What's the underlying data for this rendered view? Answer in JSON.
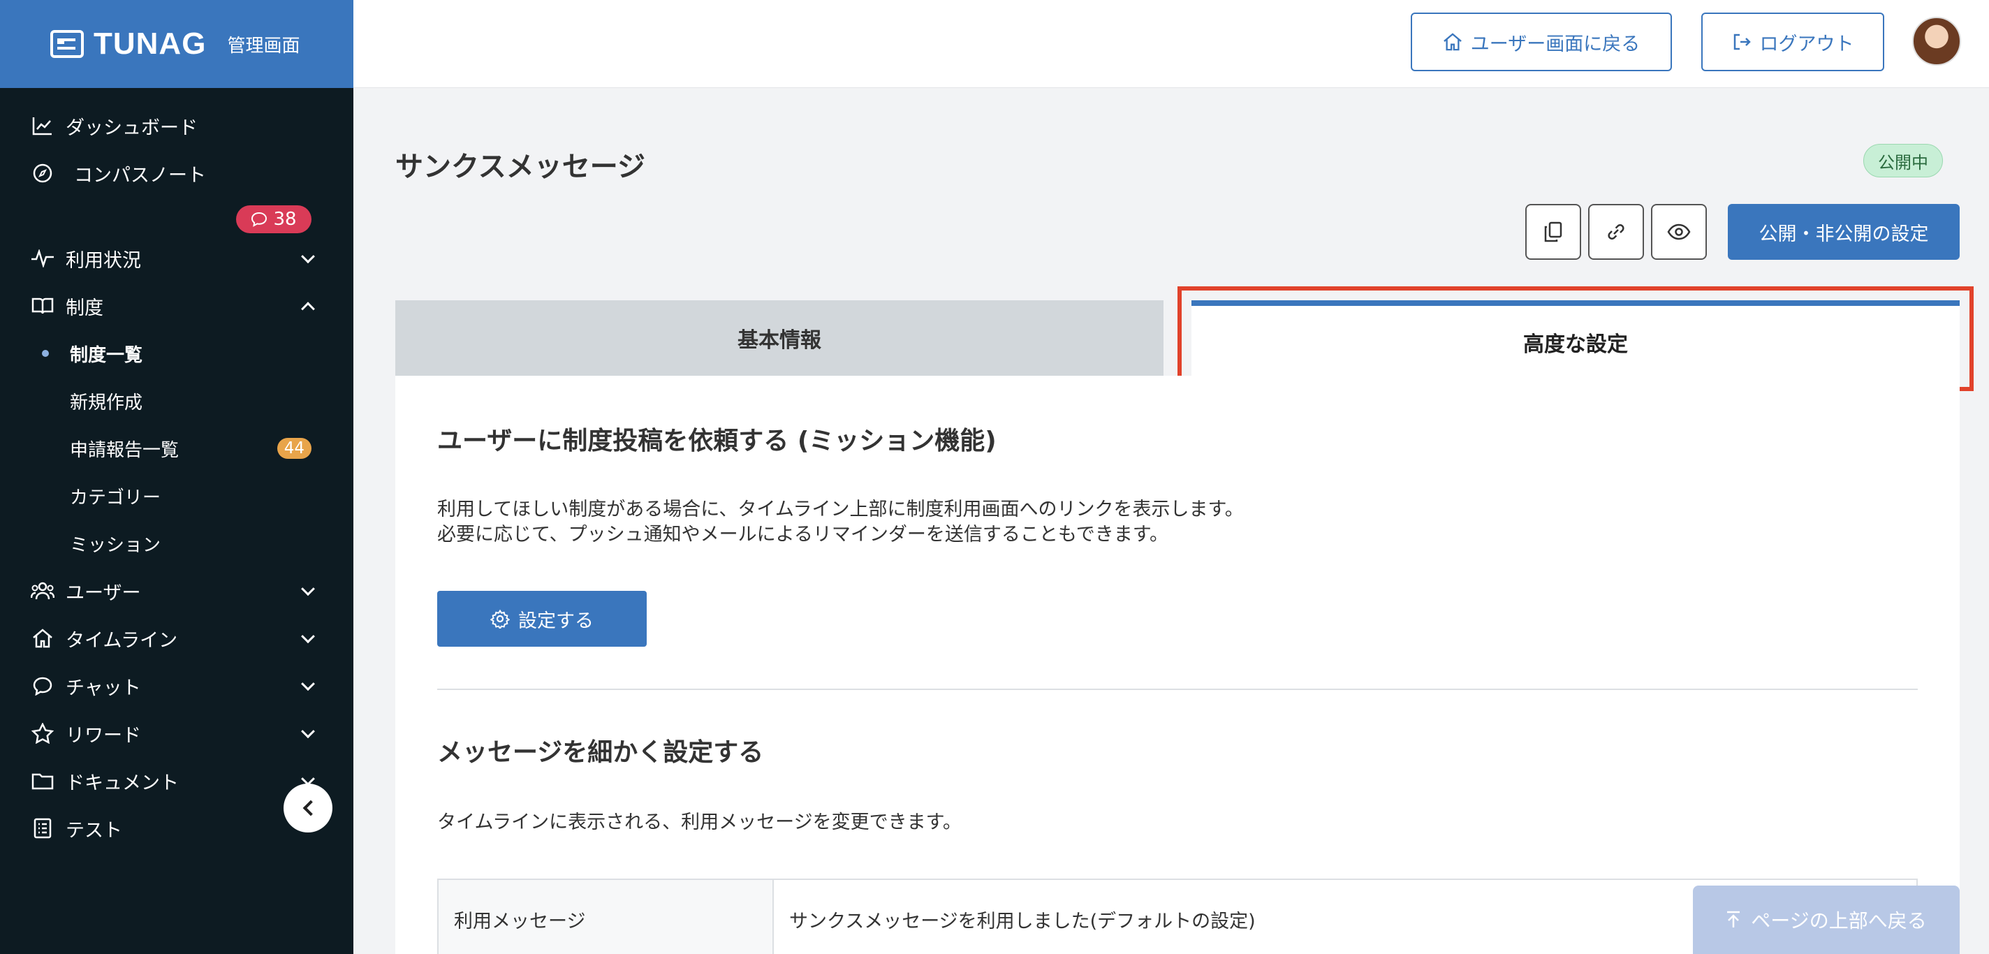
{
  "brand": {
    "name": "TUNAG",
    "subtitle": "管理画面"
  },
  "sidebar": {
    "chat_badge": "38",
    "items": [
      {
        "label": "ダッシュボード",
        "icon": "chart-line-icon"
      },
      {
        "label": "コンパスノート",
        "icon": "compass-icon"
      },
      {
        "label": "利用状況",
        "icon": "pulse-icon",
        "expand": "down"
      },
      {
        "label": "制度",
        "icon": "book-icon",
        "expand": "up"
      },
      {
        "label": "ユーザー",
        "icon": "users-icon",
        "expand": "down"
      },
      {
        "label": "タイムライン",
        "icon": "home-icon",
        "expand": "down"
      },
      {
        "label": "チャット",
        "icon": "chat-icon",
        "expand": "down"
      },
      {
        "label": "リワード",
        "icon": "star-icon",
        "expand": "down"
      },
      {
        "label": "ドキュメント",
        "icon": "folder-icon",
        "expand": "down"
      },
      {
        "label": "テスト",
        "icon": "checklist-icon"
      }
    ],
    "subitems": [
      {
        "label": "制度一覧",
        "active": true
      },
      {
        "label": "新規作成"
      },
      {
        "label": "申請報告一覧",
        "badge": "44"
      },
      {
        "label": "カテゴリー"
      },
      {
        "label": "ミッション"
      }
    ]
  },
  "header": {
    "user_screen_label": "ユーザー画面に戻る",
    "logout_label": "ログアウト"
  },
  "page": {
    "title": "サンクスメッセージ",
    "status": "公開中",
    "publish_label": "公開・非公開の設定",
    "tabs": {
      "basic": "基本情報",
      "advanced": "高度な設定"
    }
  },
  "mission": {
    "heading": "ユーザーに制度投稿を依頼する (ミッション機能)",
    "desc1": "利用してほしい制度がある場合に、タイムライン上部に制度利用画面へのリンクを表示します。",
    "desc2": "必要に応じて、プッシュ通知やメールによるリマインダーを送信することもできます。",
    "button": "設定する"
  },
  "message": {
    "heading": "メッセージを細かく設定する",
    "desc": "タイムラインに表示される、利用メッセージを変更できます。",
    "row_key": "利用メッセージ",
    "row_value": "サンクスメッセージを利用しました(デフォルトの設定)"
  },
  "to_top_label": "ページの上部へ戻る",
  "colors": {
    "primary": "#3a76bd",
    "sidebar": "#0d1b22",
    "highlight": "#e1422b",
    "badge_red": "#d93b57",
    "badge_orange": "#e8a44a"
  }
}
